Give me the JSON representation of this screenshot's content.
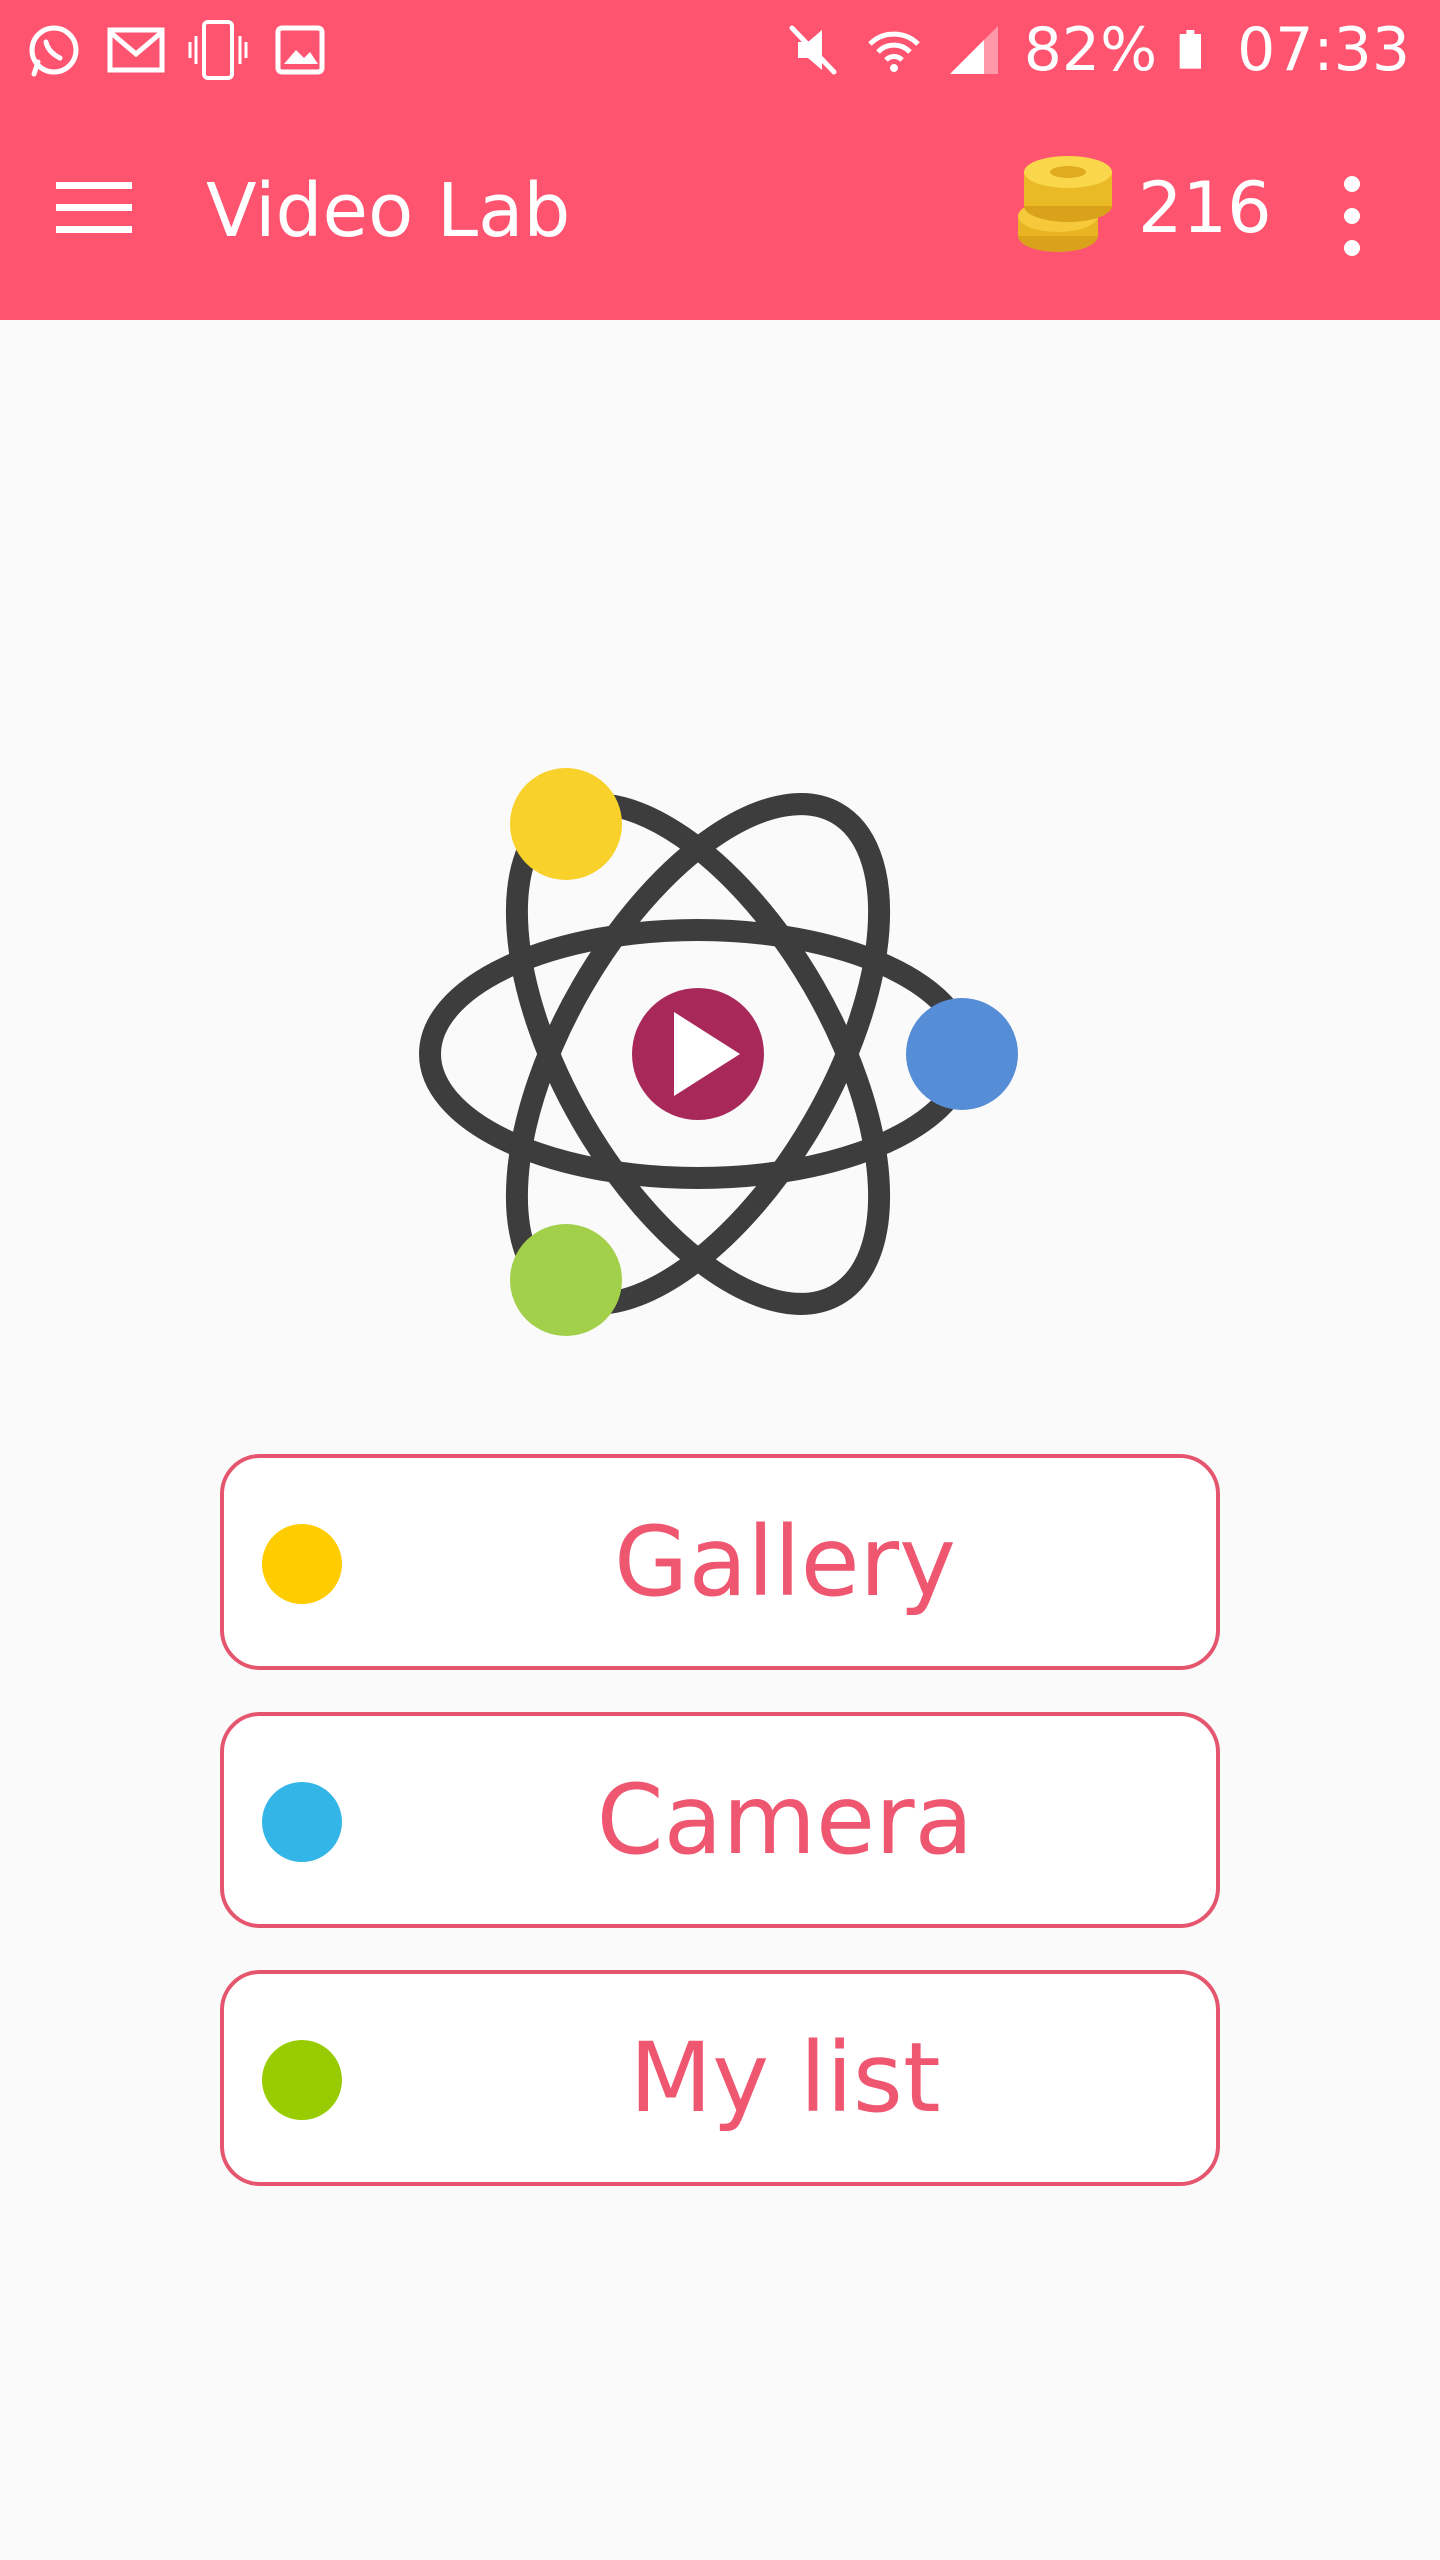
{
  "status_bar": {
    "battery": "82%",
    "time": "07:33",
    "left_icons": [
      "whatsapp-icon",
      "gmail-icon",
      "vibrate-phone-icon",
      "image-icon"
    ],
    "right_icons": [
      "mute-icon",
      "wifi-icon",
      "signal-icon",
      "battery-icon"
    ]
  },
  "toolbar": {
    "title": "Video Lab",
    "coin_count": "216",
    "icons": {
      "menu": "hamburger-menu-icon",
      "coins": "coin-stack-icon",
      "more": "more-vert-icon"
    }
  },
  "colors": {
    "app_bar": "#ff5470",
    "accent": "#ef5670",
    "background": "#fafafa",
    "logo_play": "#a8285a",
    "orbit": "#3d3d3d",
    "atom_yellow": "#f8d12a",
    "atom_blue": "#558dd6",
    "atom_green": "#a2d04a"
  },
  "actions": [
    {
      "id": "gallery",
      "label": "Gallery",
      "dot_color": "#ffcc00"
    },
    {
      "id": "camera",
      "label": "Camera",
      "dot_color": "#33b5e8"
    },
    {
      "id": "mylist",
      "label": "My list",
      "dot_color": "#99cc00"
    }
  ]
}
